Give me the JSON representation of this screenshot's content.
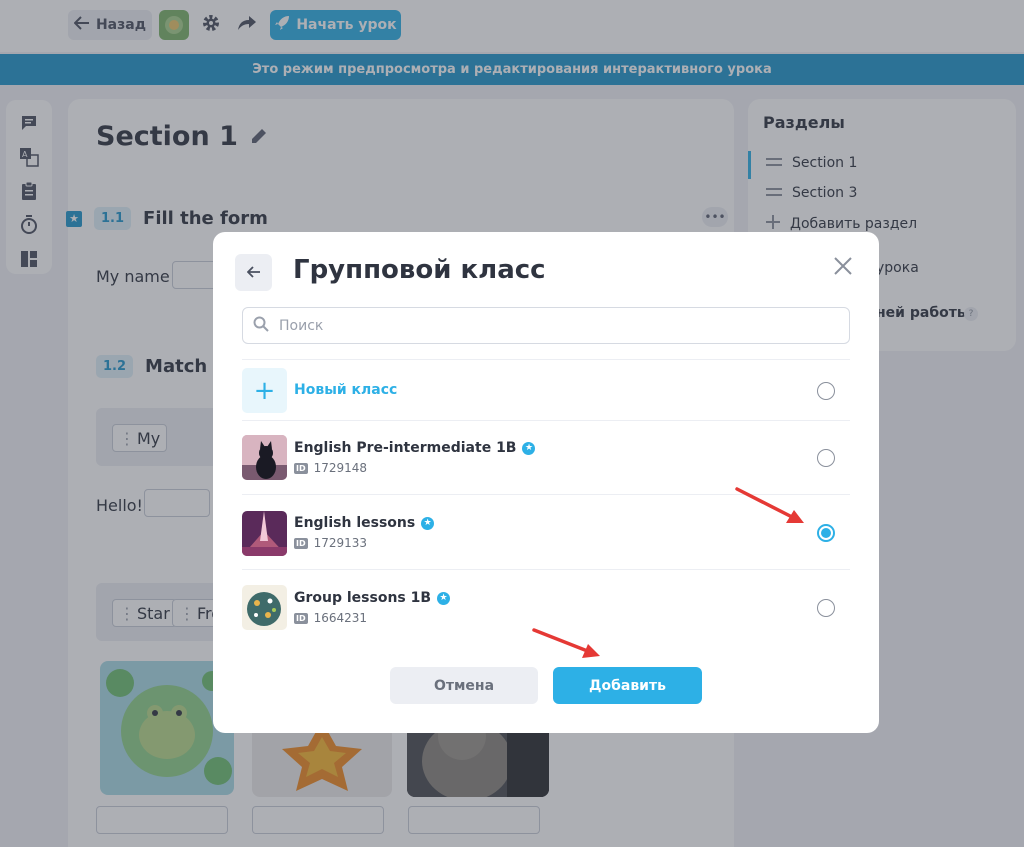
{
  "topbar": {
    "back_label": "Назад",
    "start_label": "Начать урок"
  },
  "banner": "Это режим предпросмотра и редактирования интерактивного урока",
  "main": {
    "section_title": "Section 1",
    "tasks": [
      {
        "num": "1.1",
        "title": "Fill the form"
      },
      {
        "num": "1.2",
        "title": "Match ite"
      }
    ],
    "my_name_label": "My name",
    "chip_my": "My",
    "hello_label": "Hello!",
    "chip_star": "Star",
    "chip_frog": "Frog"
  },
  "right": {
    "title": "Разделы",
    "items": [
      {
        "label": "Section 1",
        "icon": "drag-handle-icon"
      },
      {
        "label": "Section 3",
        "icon": "drag-handle-icon"
      },
      {
        "label": "Добавить раздел",
        "icon": "plus-icon"
      }
    ],
    "partial_1": "урока",
    "partial_2": "ней работы"
  },
  "modal": {
    "title": "Групповой класс",
    "search_placeholder": "Поиск",
    "new_class_label": "Новый класс",
    "classes": [
      {
        "name": "English Pre-intermediate 1B",
        "id": "1729148",
        "selected": false
      },
      {
        "name": "English lessons",
        "id": "1729133",
        "selected": true
      },
      {
        "name": "Group lessons 1B",
        "id": "1664231",
        "selected": false
      }
    ],
    "id_tag": "ID",
    "cancel_label": "Отмена",
    "add_label": "Добавить"
  },
  "colors": {
    "accent": "#2db0e6",
    "banner": "#2196cc",
    "annotation_arrow": "#e53935"
  }
}
